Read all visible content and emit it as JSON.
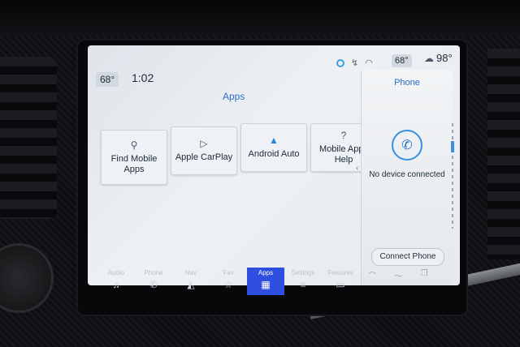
{
  "status_bar": {
    "cabin_temp": "68°",
    "time": "1:02",
    "passenger_temp": "68°",
    "outside_temp": "98°",
    "icons": [
      "alexa-icon",
      "mute-icon",
      "wifi-icon",
      "cloud-icon"
    ]
  },
  "apps": {
    "title": "Apps",
    "tiles": [
      {
        "label": "Find Mobile Apps",
        "icon": "search-apps-icon",
        "glyph": "⚲"
      },
      {
        "label": "Apple CarPlay",
        "icon": "carplay-icon",
        "glyph": "▷"
      },
      {
        "label": "Android Auto",
        "icon": "android-auto-icon",
        "glyph": "▲"
      },
      {
        "label": "Mobile Apps Help",
        "icon": "help-icon",
        "glyph": "?"
      }
    ]
  },
  "phone": {
    "title": "Phone",
    "status": "No device connected",
    "connect_label": "Connect Phone"
  },
  "nav": {
    "items": [
      {
        "label": "Audio",
        "icon": "music-note-icon",
        "glyph": "♫"
      },
      {
        "label": "Phone",
        "icon": "phone-icon",
        "glyph": "✆"
      },
      {
        "label": "Nav",
        "icon": "navigation-icon",
        "glyph": "◭"
      },
      {
        "label": "Fav",
        "icon": "star-icon",
        "glyph": "☆"
      },
      {
        "label": "Apps",
        "icon": "apps-grid-icon",
        "glyph": "▦"
      },
      {
        "label": "Settings",
        "icon": "settings-sliders-icon",
        "glyph": "≡"
      },
      {
        "label": "Features",
        "icon": "vehicle-icon",
        "glyph": "▭"
      }
    ],
    "active": "Apps"
  },
  "colors": {
    "accent": "#2b6ec8",
    "active_tab": "#2f4fe0"
  }
}
